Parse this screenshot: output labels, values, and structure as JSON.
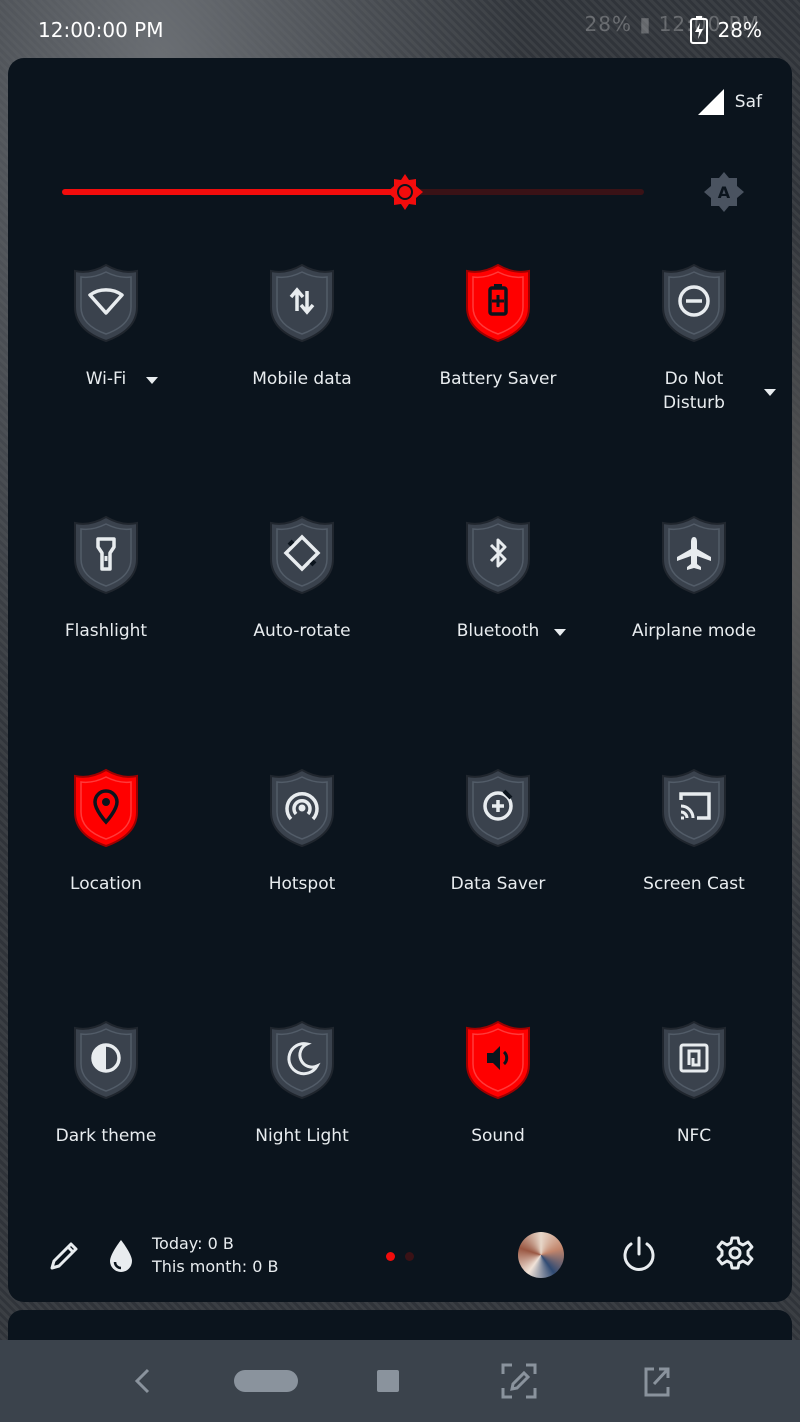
{
  "status_bar": {
    "time": "12:00:00 PM",
    "battery_percent": "28%",
    "ghost_text": "28% ▮ 12:00 PM"
  },
  "carrier": {
    "label": "Saf",
    "icon": "signal-icon"
  },
  "brightness": {
    "level": 0.59,
    "auto_icon": "auto-brightness-icon"
  },
  "colors": {
    "panel": "#0b141d",
    "shield_off": "#3a424d",
    "shield_on": "#ff0000",
    "accent": "#f20c0c",
    "text": "#e8ecef"
  },
  "tiles": [
    {
      "label": "Wi-Fi",
      "icon": "wifi-icon",
      "active": false,
      "dropdown": true
    },
    {
      "label": "Mobile data",
      "icon": "mobile-data-icon",
      "active": false,
      "dropdown": false
    },
    {
      "label": "Battery Saver",
      "icon": "battery-saver-icon",
      "active": true,
      "dropdown": false
    },
    {
      "label": "Do Not\nDisturb",
      "icon": "do-not-disturb-icon",
      "active": false,
      "dropdown": true
    },
    {
      "label": "Flashlight",
      "icon": "flashlight-icon",
      "active": false,
      "dropdown": false
    },
    {
      "label": "Auto-rotate",
      "icon": "auto-rotate-icon",
      "active": false,
      "dropdown": false
    },
    {
      "label": "Bluetooth",
      "icon": "bluetooth-icon",
      "active": false,
      "dropdown": true
    },
    {
      "label": "Airplane mode",
      "icon": "airplane-icon",
      "active": false,
      "dropdown": false
    },
    {
      "label": "Location",
      "icon": "location-icon",
      "active": true,
      "dropdown": false
    },
    {
      "label": "Hotspot",
      "icon": "hotspot-icon",
      "active": false,
      "dropdown": false
    },
    {
      "label": "Data Saver",
      "icon": "data-saver-icon",
      "active": false,
      "dropdown": false
    },
    {
      "label": "Screen Cast",
      "icon": "screen-cast-icon",
      "active": false,
      "dropdown": false
    },
    {
      "label": "Dark theme",
      "icon": "dark-theme-icon",
      "active": false,
      "dropdown": false
    },
    {
      "label": "Night Light",
      "icon": "night-light-icon",
      "active": false,
      "dropdown": false
    },
    {
      "label": "Sound",
      "icon": "sound-icon",
      "active": true,
      "dropdown": false
    },
    {
      "label": "NFC",
      "icon": "nfc-icon",
      "active": false,
      "dropdown": false
    }
  ],
  "footer": {
    "usage_today": "Today: 0 B",
    "usage_month": "This month: 0 B",
    "pages": 2,
    "current_page": 1,
    "icons": [
      "edit-icon",
      "data-usage-icon",
      "user-avatar",
      "power-icon",
      "settings-icon"
    ]
  },
  "navbar": {
    "icons": [
      "back-icon",
      "home-pill-icon",
      "recents-icon",
      "screenshot-edit-icon",
      "open-external-icon"
    ]
  }
}
